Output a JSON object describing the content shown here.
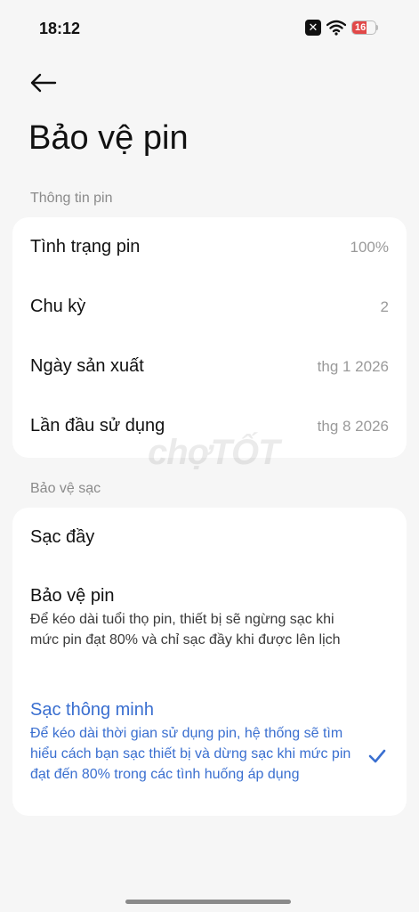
{
  "status_bar": {
    "time": "18:12",
    "battery_level": "16",
    "icons": [
      "x-notification-icon",
      "wifi-icon",
      "battery-icon"
    ]
  },
  "header": {
    "back_icon": "arrow-left-icon",
    "title": "Bảo vệ pin"
  },
  "battery_info": {
    "section_title": "Thông tin pin",
    "rows": [
      {
        "label": "Tình trạng pin",
        "value": "100%"
      },
      {
        "label": "Chu kỳ",
        "value": "2"
      },
      {
        "label": "Ngày sản xuất",
        "value": "thg 1 2026"
      },
      {
        "label": "Lần đầu sử dụng",
        "value": "thg 8 2026"
      }
    ]
  },
  "charge_protection": {
    "section_title": "Bảo vệ sạc",
    "options": [
      {
        "title": "Sạc đầy",
        "desc": "",
        "selected": false
      },
      {
        "title": "Bảo vệ pin",
        "desc": "Để kéo dài tuổi thọ pin, thiết bị sẽ ngừng sạc khi mức pin đạt 80% và chỉ sạc đầy khi được lên lịch",
        "selected": false
      },
      {
        "title": "Sạc thông minh",
        "desc": "Để kéo dài thời gian sử dụng pin, hệ thống sẽ tìm hiểu cách bạn sạc thiết bị và dừng sạc khi mức pin đạt đến 80% trong các tình huống áp dụng",
        "selected": true
      }
    ]
  },
  "watermark": "chợTỐT",
  "colors": {
    "background": "#f6f6f6",
    "card": "#ffffff",
    "accent": "#3a6fd0",
    "secondary_text": "#9a9a9a",
    "battery_low": "#e14848"
  }
}
